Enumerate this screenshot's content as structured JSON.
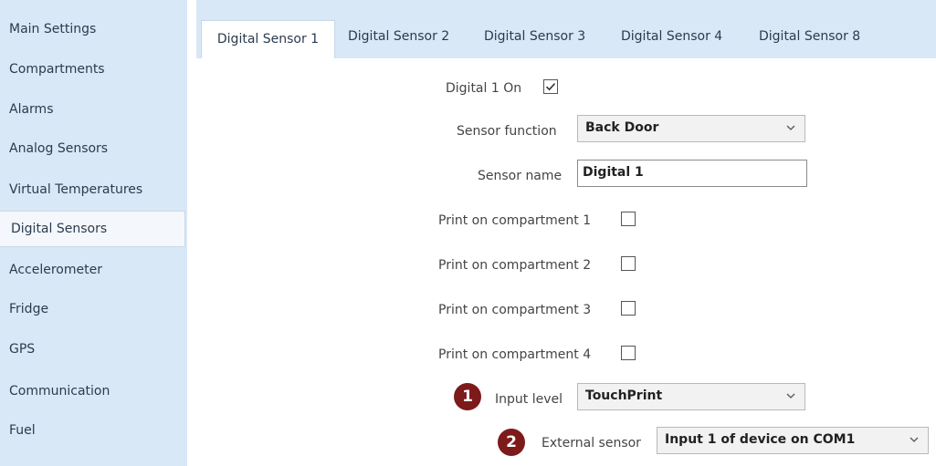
{
  "sidebar": {
    "items": [
      {
        "label": "Main Settings"
      },
      {
        "label": "Compartments"
      },
      {
        "label": "Alarms"
      },
      {
        "label": "Analog Sensors"
      },
      {
        "label": "Virtual Temperatures"
      },
      {
        "label": "Digital Sensors"
      },
      {
        "label": "Accelerometer"
      },
      {
        "label": "Fridge"
      },
      {
        "label": "GPS"
      },
      {
        "label": "Communication"
      },
      {
        "label": "Fuel"
      }
    ],
    "active_index": 5
  },
  "tabs": [
    {
      "label": "Digital Sensor 1"
    },
    {
      "label": "Digital Sensor 2"
    },
    {
      "label": "Digital Sensor 3"
    },
    {
      "label": "Digital Sensor 4"
    },
    {
      "label": "Digital Sensor 8"
    }
  ],
  "form": {
    "digital_on": {
      "label": "Digital 1 On",
      "checked": true
    },
    "sensor_function": {
      "label": "Sensor function",
      "value": "Back Door"
    },
    "sensor_name": {
      "label": "Sensor name",
      "value": "Digital 1"
    },
    "print_comp_1": {
      "label": "Print on compartment 1",
      "checked": false
    },
    "print_comp_2": {
      "label": "Print on compartment 2",
      "checked": false
    },
    "print_comp_3": {
      "label": "Print on compartment 3",
      "checked": false
    },
    "print_comp_4": {
      "label": "Print on compartment 4",
      "checked": false
    },
    "input_level": {
      "label": "Input level",
      "value": "TouchPrint",
      "badge": "1"
    },
    "external_sensor": {
      "label": "External sensor",
      "value": "Input 1 of device on COM1",
      "badge": "2"
    }
  },
  "colors": {
    "sidebar_bg": "#d9e8f7",
    "badge_bg": "#7d1a1a"
  }
}
